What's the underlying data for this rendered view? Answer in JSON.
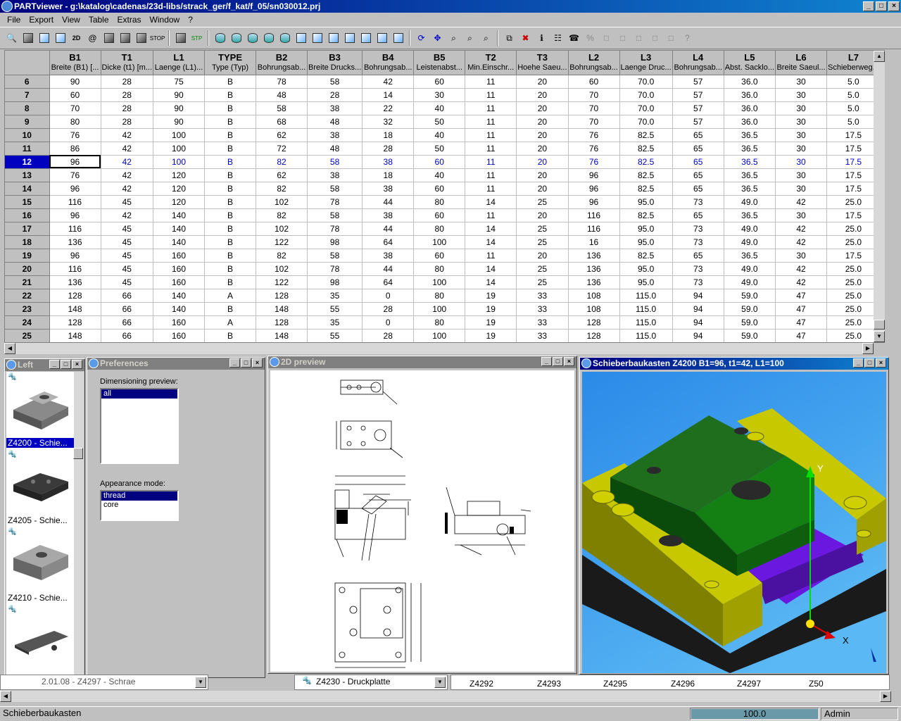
{
  "window": {
    "title": "PARTviewer - g:\\katalog\\cadenas/23d-libs/strack_ger/f_kat/f_05/sn030012.prj"
  },
  "menu": [
    "File",
    "Export",
    "View",
    "Table",
    "Extras",
    "Window",
    "?"
  ],
  "table": {
    "columns": [
      {
        "code": "B1",
        "desc": "Breite (B1) [..."
      },
      {
        "code": "T1",
        "desc": "Dicke (t1) [m..."
      },
      {
        "code": "L1",
        "desc": "Laenge (L1)..."
      },
      {
        "code": "TYPE",
        "desc": "Type (Typ)"
      },
      {
        "code": "B2",
        "desc": "Bohrungsab..."
      },
      {
        "code": "B3",
        "desc": "Breite Drucks..."
      },
      {
        "code": "B4",
        "desc": "Bohrungsab..."
      },
      {
        "code": "B5",
        "desc": "Leistenabst..."
      },
      {
        "code": "T2",
        "desc": "Min.Einschr..."
      },
      {
        "code": "T3",
        "desc": "Hoehe Saeu..."
      },
      {
        "code": "L2",
        "desc": "Bohrungsab..."
      },
      {
        "code": "L3",
        "desc": "Laenge Druc..."
      },
      {
        "code": "L4",
        "desc": "Bohrungsab..."
      },
      {
        "code": "L5",
        "desc": "Abst. Sacklo..."
      },
      {
        "code": "L6",
        "desc": "Breite Saeul..."
      },
      {
        "code": "L7",
        "desc": "Schieberweg..."
      }
    ],
    "selected_row": 12,
    "rows": [
      {
        "n": "6",
        "v": [
          "90",
          "28",
          "75",
          "B",
          "78",
          "58",
          "42",
          "60",
          "11",
          "20",
          "60",
          "70.0",
          "57",
          "36.0",
          "30",
          "5.0"
        ]
      },
      {
        "n": "7",
        "v": [
          "60",
          "28",
          "90",
          "B",
          "48",
          "28",
          "14",
          "30",
          "11",
          "20",
          "70",
          "70.0",
          "57",
          "36.0",
          "30",
          "5.0"
        ]
      },
      {
        "n": "8",
        "v": [
          "70",
          "28",
          "90",
          "B",
          "58",
          "38",
          "22",
          "40",
          "11",
          "20",
          "70",
          "70.0",
          "57",
          "36.0",
          "30",
          "5.0"
        ]
      },
      {
        "n": "9",
        "v": [
          "80",
          "28",
          "90",
          "B",
          "68",
          "48",
          "32",
          "50",
          "11",
          "20",
          "70",
          "70.0",
          "57",
          "36.0",
          "30",
          "5.0"
        ]
      },
      {
        "n": "10",
        "v": [
          "76",
          "42",
          "100",
          "B",
          "62",
          "38",
          "18",
          "40",
          "11",
          "20",
          "76",
          "82.5",
          "65",
          "36.5",
          "30",
          "17.5"
        ]
      },
      {
        "n": "11",
        "v": [
          "86",
          "42",
          "100",
          "B",
          "72",
          "48",
          "28",
          "50",
          "11",
          "20",
          "76",
          "82.5",
          "65",
          "36.5",
          "30",
          "17.5"
        ]
      },
      {
        "n": "12",
        "v": [
          "96",
          "42",
          "100",
          "B",
          "82",
          "58",
          "38",
          "60",
          "11",
          "20",
          "76",
          "82.5",
          "65",
          "36.5",
          "30",
          "17.5"
        ]
      },
      {
        "n": "13",
        "v": [
          "76",
          "42",
          "120",
          "B",
          "62",
          "38",
          "18",
          "40",
          "11",
          "20",
          "96",
          "82.5",
          "65",
          "36.5",
          "30",
          "17.5"
        ]
      },
      {
        "n": "14",
        "v": [
          "96",
          "42",
          "120",
          "B",
          "82",
          "58",
          "38",
          "60",
          "11",
          "20",
          "96",
          "82.5",
          "65",
          "36.5",
          "30",
          "17.5"
        ]
      },
      {
        "n": "15",
        "v": [
          "116",
          "45",
          "120",
          "B",
          "102",
          "78",
          "44",
          "80",
          "14",
          "25",
          "96",
          "95.0",
          "73",
          "49.0",
          "42",
          "25.0"
        ]
      },
      {
        "n": "16",
        "v": [
          "96",
          "42",
          "140",
          "B",
          "82",
          "58",
          "38",
          "60",
          "11",
          "20",
          "116",
          "82.5",
          "65",
          "36.5",
          "30",
          "17.5"
        ]
      },
      {
        "n": "17",
        "v": [
          "116",
          "45",
          "140",
          "B",
          "102",
          "78",
          "44",
          "80",
          "14",
          "25",
          "116",
          "95.0",
          "73",
          "49.0",
          "42",
          "25.0"
        ]
      },
      {
        "n": "18",
        "v": [
          "136",
          "45",
          "140",
          "B",
          "122",
          "98",
          "64",
          "100",
          "14",
          "25",
          "16",
          "95.0",
          "73",
          "49.0",
          "42",
          "25.0"
        ]
      },
      {
        "n": "19",
        "v": [
          "96",
          "45",
          "160",
          "B",
          "82",
          "58",
          "38",
          "60",
          "11",
          "20",
          "136",
          "82.5",
          "65",
          "36.5",
          "30",
          "17.5"
        ]
      },
      {
        "n": "20",
        "v": [
          "116",
          "45",
          "160",
          "B",
          "102",
          "78",
          "44",
          "80",
          "14",
          "25",
          "136",
          "95.0",
          "73",
          "49.0",
          "42",
          "25.0"
        ]
      },
      {
        "n": "21",
        "v": [
          "136",
          "45",
          "160",
          "B",
          "122",
          "98",
          "64",
          "100",
          "14",
          "25",
          "136",
          "95.0",
          "73",
          "49.0",
          "42",
          "25.0"
        ]
      },
      {
        "n": "22",
        "v": [
          "128",
          "66",
          "140",
          "A",
          "128",
          "35",
          "0",
          "80",
          "19",
          "33",
          "108",
          "115.0",
          "94",
          "59.0",
          "47",
          "25.0"
        ]
      },
      {
        "n": "23",
        "v": [
          "148",
          "66",
          "140",
          "B",
          "148",
          "55",
          "28",
          "100",
          "19",
          "33",
          "108",
          "115.0",
          "94",
          "59.0",
          "47",
          "25.0"
        ]
      },
      {
        "n": "24",
        "v": [
          "128",
          "66",
          "160",
          "A",
          "128",
          "35",
          "0",
          "80",
          "19",
          "33",
          "128",
          "115.0",
          "94",
          "59.0",
          "47",
          "25.0"
        ]
      },
      {
        "n": "25",
        "v": [
          "148",
          "66",
          "160",
          "B",
          "148",
          "55",
          "28",
          "100",
          "19",
          "33",
          "128",
          "115.0",
          "94",
          "59.0",
          "47",
          "25.0"
        ]
      }
    ]
  },
  "left_panel": {
    "title": "Left",
    "items": [
      "Z4200 - Schie...",
      "Z4205 - Schie...",
      "Z4210 - Schie...",
      ""
    ]
  },
  "preferences": {
    "title": "Preferences",
    "dim_label": "Dimensioning preview:",
    "dim_options": [
      "all"
    ],
    "appearance_label": "Appearance mode:",
    "appearance_options": [
      "thread",
      "core"
    ]
  },
  "preview2d": {
    "title": "2D preview"
  },
  "preview3d": {
    "title": "Schieberbaukasten Z4200 B1=96, t1=42, L1=100",
    "axis_x": "X",
    "axis_y": "Y"
  },
  "bottom": {
    "item1": "2.01.08 - Z4297 - Schrae",
    "item2": "Z4230  -  Druckplatte",
    "codes": [
      "Z4292",
      "Z4293",
      "Z4295",
      "Z4296",
      "Z4297",
      "Z50"
    ]
  },
  "status": {
    "text": "Schieberbaukasten",
    "progress": "100.0",
    "user": "Admin"
  }
}
